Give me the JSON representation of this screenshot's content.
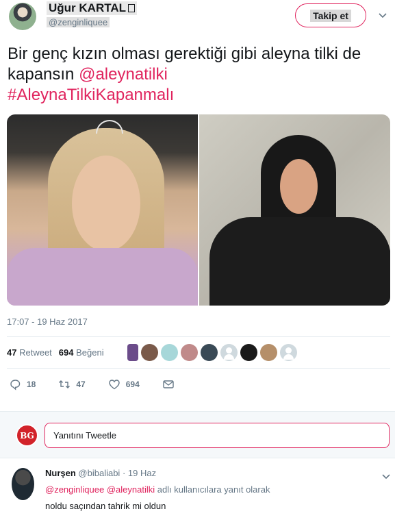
{
  "author": {
    "name": "Uğur KARTAL",
    "handle": "@zenginliquee",
    "follow_label": "Takip et"
  },
  "tweet": {
    "text_plain": "Bir genç kızın olması gerektiği gibi aleyna tilki de kapansın ",
    "mention": "@aleynatilki",
    "hashtag": "#AleynaTilkiKapanmalı",
    "timestamp": "17:07 - 19 Haz 2017"
  },
  "stats": {
    "retweet_count": "47",
    "retweet_label": "Retweet",
    "like_count": "694",
    "like_label": "Beğeni",
    "liker_avatars": [
      "purple",
      "brown",
      "teal",
      "pink",
      "dark",
      "default",
      "black",
      "tan",
      "default"
    ]
  },
  "actions": {
    "reply_count": "18",
    "retweet_count": "47",
    "like_count": "694"
  },
  "reply_box": {
    "avatar_text": "BG",
    "placeholder": "Yanıtını Tweetle"
  },
  "reply": {
    "name": "Nurşen",
    "handle": "@bibaliabi",
    "sep": "·",
    "date": "19 Haz",
    "mention1": "@zenginliquee",
    "mention2": "@aleynatilki",
    "context_suffix": " adlı kullanıcılara yanıt olarak",
    "body": "noldu saçından tahrik mi oldun"
  },
  "colors": {
    "accent": "#e0245e",
    "muted": "#657786"
  }
}
